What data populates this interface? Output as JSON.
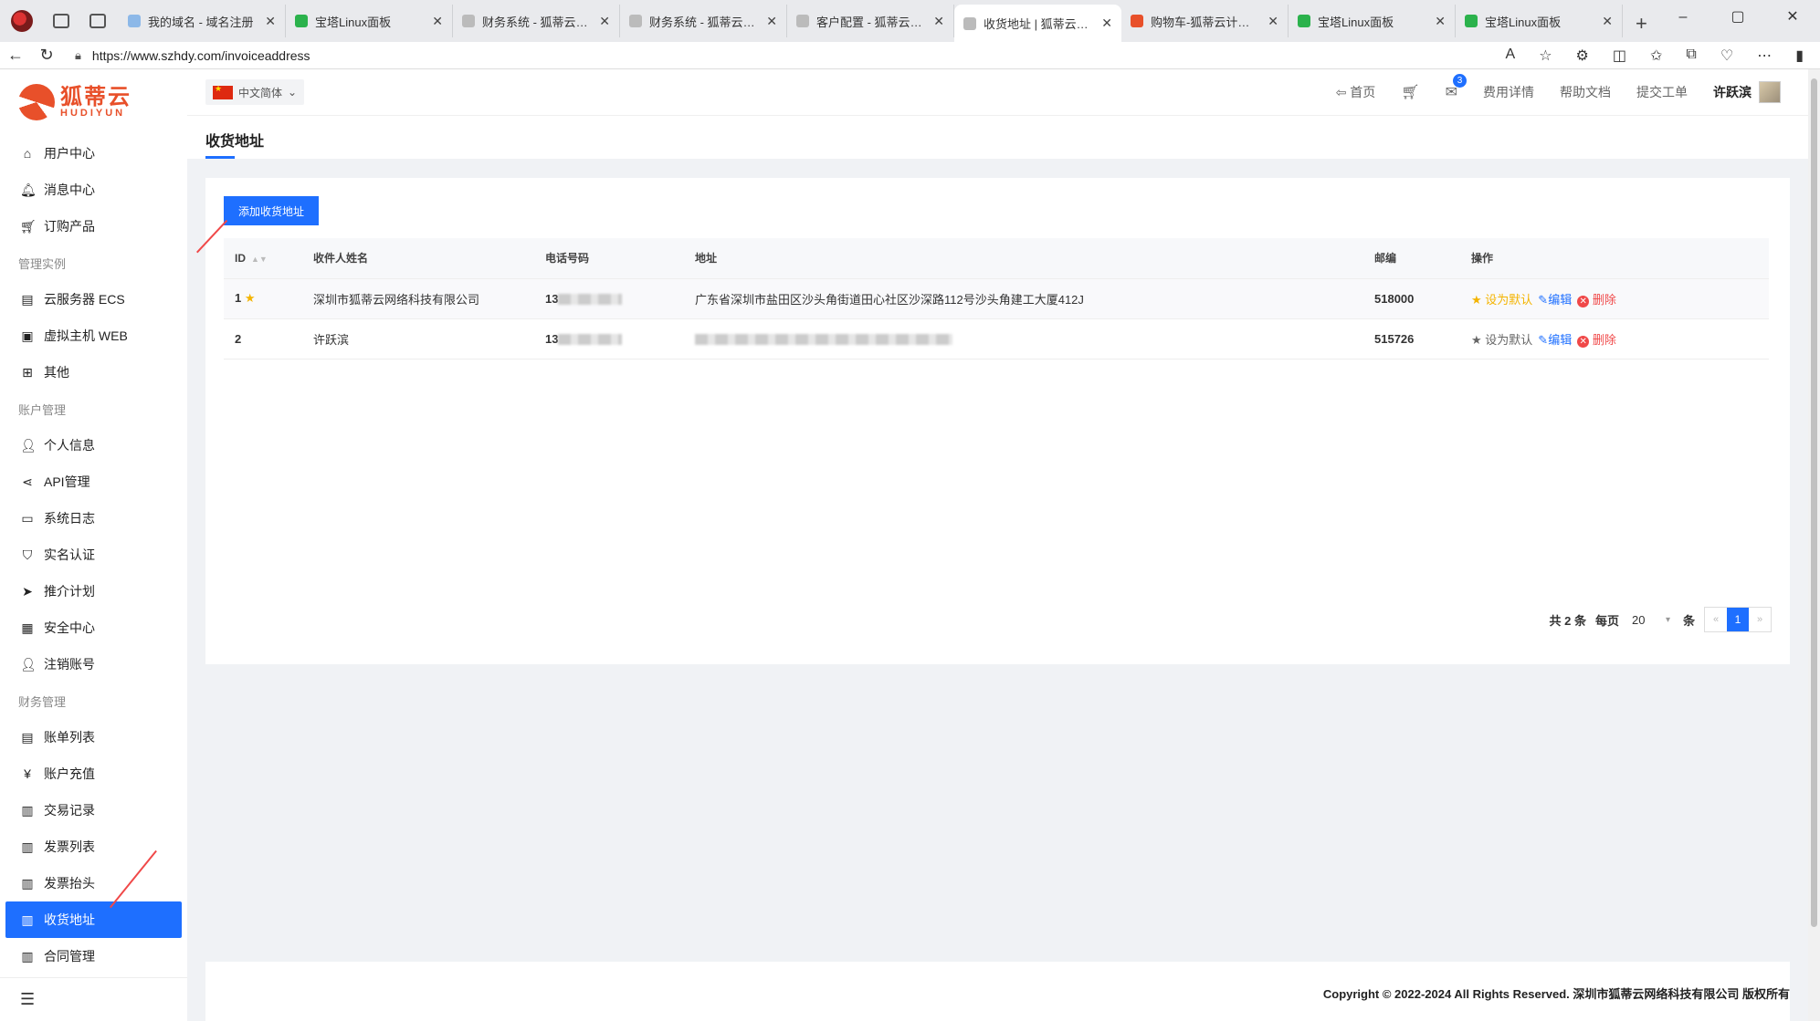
{
  "browser": {
    "tabs": [
      {
        "title": "我的域名 - 域名注册",
        "color": "#8cb8e8"
      },
      {
        "title": "宝塔Linux面板",
        "color": "#2bb24c"
      },
      {
        "title": "财务系统 - 狐蒂云计算",
        "color": "#bbbbbb"
      },
      {
        "title": "财务系统 - 狐蒂云计算",
        "color": "#bbbbbb"
      },
      {
        "title": "客户配置 - 狐蒂云计算",
        "color": "#bbbbbb"
      },
      {
        "title": "收货地址 | 狐蒂云计算",
        "color": "#bbbbbb",
        "active": true
      },
      {
        "title": "购物车-狐蒂云计算平台",
        "color": "#e8502a"
      },
      {
        "title": "宝塔Linux面板",
        "color": "#2bb24c"
      },
      {
        "title": "宝塔Linux面板",
        "color": "#2bb24c"
      }
    ],
    "url": "https://www.szhdy.com/invoiceaddress"
  },
  "logo": {
    "cn": "狐蒂云",
    "en": "HUDIYUN"
  },
  "sidebar": {
    "items": [
      {
        "type": "item",
        "label": "用户中心",
        "icon": "⌂",
        "name": "home-icon"
      },
      {
        "type": "item",
        "label": "消息中心",
        "icon": "🔔︎",
        "name": "bell-icon"
      },
      {
        "type": "item",
        "label": "订购产品",
        "icon": "🛒︎",
        "name": "cart-icon"
      },
      {
        "type": "group",
        "label": "管理实例"
      },
      {
        "type": "item",
        "label": "云服务器 ECS",
        "icon": "▤",
        "name": "server-icon"
      },
      {
        "type": "item",
        "label": "虚拟主机 WEB",
        "icon": "▣",
        "name": "host-icon"
      },
      {
        "type": "item",
        "label": "其他",
        "icon": "⊞",
        "name": "grid-icon"
      },
      {
        "type": "group",
        "label": "账户管理"
      },
      {
        "type": "item",
        "label": "个人信息",
        "icon": "👤︎",
        "name": "user-icon"
      },
      {
        "type": "item",
        "label": "API管理",
        "icon": "⋖",
        "name": "share-icon"
      },
      {
        "type": "item",
        "label": "系统日志",
        "icon": "▭",
        "name": "log-icon"
      },
      {
        "type": "item",
        "label": "实名认证",
        "icon": "⛉",
        "name": "shield-icon"
      },
      {
        "type": "item",
        "label": "推介计划",
        "icon": "➤",
        "name": "send-icon"
      },
      {
        "type": "item",
        "label": "安全中心",
        "icon": "▦",
        "name": "idcard-icon"
      },
      {
        "type": "item",
        "label": "注销账号",
        "icon": "👤︎",
        "name": "user-remove-icon"
      },
      {
        "type": "group",
        "label": "财务管理"
      },
      {
        "type": "item",
        "label": "账单列表",
        "icon": "▤",
        "name": "bill-icon"
      },
      {
        "type": "item",
        "label": "账户充值",
        "icon": "¥",
        "name": "yen-icon"
      },
      {
        "type": "item",
        "label": "交易记录",
        "icon": "▥",
        "name": "record-icon"
      },
      {
        "type": "item",
        "label": "发票列表",
        "icon": "▥",
        "name": "invoice-icon"
      },
      {
        "type": "item",
        "label": "发票抬头",
        "icon": "▥",
        "name": "invoice-title-icon"
      },
      {
        "type": "item",
        "label": "收货地址",
        "icon": "▥",
        "name": "address-icon",
        "active": true
      },
      {
        "type": "item",
        "label": "合同管理",
        "icon": "▥",
        "name": "contract-icon"
      }
    ]
  },
  "topbar": {
    "lang": "中文简体",
    "home": "首页",
    "msg_count": "3",
    "fee": "费用详情",
    "help": "帮助文档",
    "ticket": "提交工单",
    "user": "许跃滨"
  },
  "page": {
    "title": "收货地址",
    "add_button": "添加收货地址"
  },
  "table": {
    "headers": [
      "ID",
      "收件人姓名",
      "电话号码",
      "地址",
      "邮编",
      "操作"
    ],
    "rows": [
      {
        "id": "1",
        "default": true,
        "name": "深圳市狐蒂云网络科技有限公司",
        "phone": "13",
        "address": "广东省深圳市盐田区沙头角街道田心社区沙深路112号沙头角建工大厦412J",
        "zip": "518000"
      },
      {
        "id": "2",
        "default": false,
        "name": "许跃滨",
        "phone": "13",
        "address": "",
        "zip": "515726"
      }
    ],
    "ops": {
      "set_default": "设为默认",
      "edit": "编辑",
      "delete": "删除"
    }
  },
  "pager": {
    "total": "共 2 条",
    "per_page": "每页",
    "size": "20",
    "unit": "条",
    "current": "1"
  },
  "footer": {
    "copyright": "Copyright © 2022-2024 All Rights Reserved. 深圳市狐蒂云网络科技有限公司 版权所有"
  },
  "colors": {
    "accent": "#1e6fff",
    "danger": "#f04848",
    "star": "#f4b400",
    "brand": "#e8502a"
  }
}
